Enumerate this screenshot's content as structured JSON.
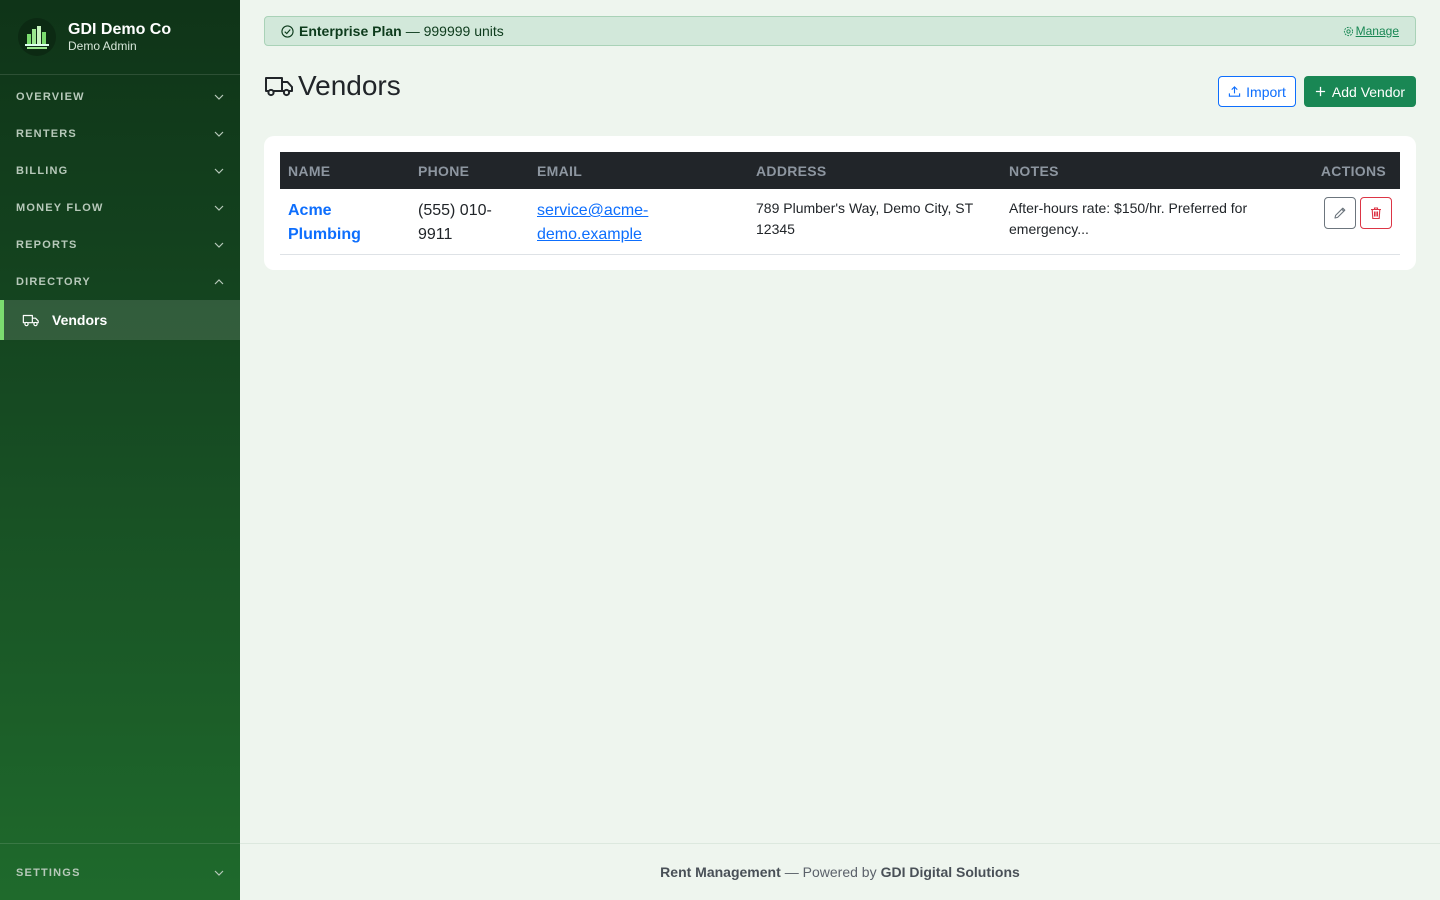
{
  "sidebar": {
    "brand_name": "GDI Demo Co",
    "brand_sub": "Demo Admin",
    "sections": [
      {
        "label": "OVERVIEW",
        "expanded": false
      },
      {
        "label": "RENTERS",
        "expanded": false
      },
      {
        "label": "BILLING",
        "expanded": false
      },
      {
        "label": "MONEY FLOW",
        "expanded": false
      },
      {
        "label": "REPORTS",
        "expanded": false
      },
      {
        "label": "DIRECTORY",
        "expanded": true
      }
    ],
    "active_item": {
      "label": "Vendors",
      "icon": "truck-icon"
    },
    "settings_label": "SETTINGS"
  },
  "plan_bar": {
    "plan_name": "Enterprise Plan",
    "units_text": "— 999999 units",
    "manage_label": "Manage"
  },
  "page": {
    "title": "Vendors",
    "import_label": "Import",
    "add_label": "Add Vendor"
  },
  "table": {
    "headers": [
      "NAME",
      "PHONE",
      "EMAIL",
      "ADDRESS",
      "NOTES",
      "ACTIONS"
    ],
    "rows": [
      {
        "name": "Acme Plumbing",
        "phone": "(555) 010-9911",
        "email": "service@acme-demo.example",
        "address": "789 Plumber's Way, Demo City, ST 12345",
        "notes": "After-hours rate: $150/hr. Preferred for emergency..."
      }
    ]
  },
  "footer": {
    "app_name": "Rent Management",
    "powered_text": "— Powered by",
    "company": "GDI Digital Solutions"
  },
  "colors": {
    "sidebar_top": "#0f3418",
    "sidebar_bottom": "#1f6a2c",
    "active_indicator": "#7bdc6f",
    "primary": "#0d6efd",
    "success": "#198754",
    "danger": "#dc3545",
    "page_bg": "#eef5ee"
  }
}
